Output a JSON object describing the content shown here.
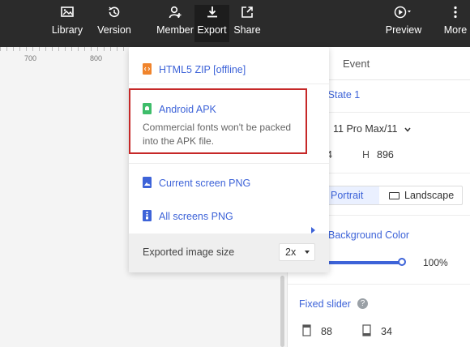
{
  "toolbar": {
    "library": "Library",
    "version": "Version",
    "member": "Member",
    "export": "Export",
    "share": "Share",
    "preview": "Preview",
    "more": "More"
  },
  "ruler": {
    "mark1": "700",
    "mark2": "800"
  },
  "export_menu": {
    "html5": "HTML5 ZIP [offline]",
    "android": "Android APK",
    "android_desc": "Commercial fonts won't be packed into the APK file.",
    "current_png": "Current screen PNG",
    "all_png": "All screens PNG",
    "size_label": "Exported image size",
    "size_value": "2x"
  },
  "right_panel": {
    "tab_event": "Event",
    "state": "- State 1",
    "device": "11 Pro Max/11",
    "w_partial": "4",
    "h_label": "H",
    "h_value": "896",
    "portrait": "Portrait",
    "landscape": "Landscape",
    "bg_color": "Background Color",
    "opacity": "100%",
    "fixed_slider": "Fixed slider",
    "help": "?",
    "fixed_top": "88",
    "fixed_bottom": "34"
  },
  "colors": {
    "accent": "#3d63d8",
    "highlight": "#c62828",
    "topbar": "#2b2b2b"
  }
}
